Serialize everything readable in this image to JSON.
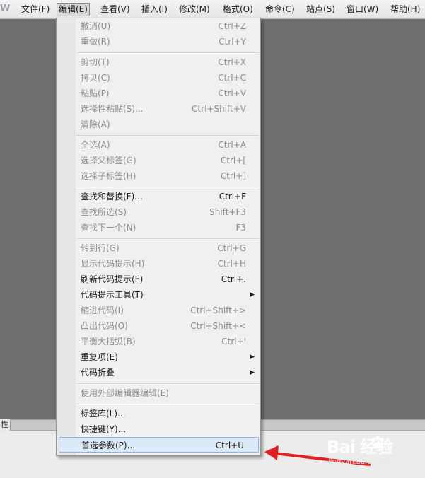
{
  "app": {
    "logo": "W"
  },
  "menubar": [
    {
      "label": "文件(F)"
    },
    {
      "label": "编辑(E)",
      "active": true
    },
    {
      "label": "查看(V)"
    },
    {
      "label": "插入(I)"
    },
    {
      "label": "修改(M)"
    },
    {
      "label": "格式(O)"
    },
    {
      "label": "命令(C)"
    },
    {
      "label": "站点(S)"
    },
    {
      "label": "窗口(W)"
    },
    {
      "label": "帮助(H)"
    }
  ],
  "edit_menu": {
    "items": [
      {
        "label": "撤消(U)",
        "shortcut": "Ctrl+Z",
        "enabled": false
      },
      {
        "label": "重做(R)",
        "shortcut": "Ctrl+Y",
        "enabled": false
      },
      {
        "label": "剪切(T)",
        "shortcut": "Ctrl+X",
        "enabled": false
      },
      {
        "label": "拷贝(C)",
        "shortcut": "Ctrl+C",
        "enabled": false
      },
      {
        "label": "粘贴(P)",
        "shortcut": "Ctrl+V",
        "enabled": false
      },
      {
        "label": "选择性粘贴(S)...",
        "shortcut": "Ctrl+Shift+V",
        "enabled": false
      },
      {
        "label": "清除(A)",
        "shortcut": "",
        "enabled": false
      },
      {
        "label": "全选(A)",
        "shortcut": "Ctrl+A",
        "enabled": false
      },
      {
        "label": "选择父标签(G)",
        "shortcut": "Ctrl+[",
        "enabled": false
      },
      {
        "label": "选择子标签(H)",
        "shortcut": "Ctrl+]",
        "enabled": false
      },
      {
        "label": "查找和替换(F)...",
        "shortcut": "Ctrl+F",
        "enabled": true
      },
      {
        "label": "查找所选(S)",
        "shortcut": "Shift+F3",
        "enabled": false
      },
      {
        "label": "查找下一个(N)",
        "shortcut": "F3",
        "enabled": false
      },
      {
        "label": "转到行(G)",
        "shortcut": "Ctrl+G",
        "enabled": false
      },
      {
        "label": "显示代码提示(H)",
        "shortcut": "Ctrl+H",
        "enabled": false
      },
      {
        "label": "刷新代码提示(F)",
        "shortcut": "Ctrl+.",
        "enabled": true
      },
      {
        "label": "代码提示工具(T)",
        "shortcut": "",
        "enabled": true,
        "submenu": true
      },
      {
        "label": "缩进代码(I)",
        "shortcut": "Ctrl+Shift+>",
        "enabled": false
      },
      {
        "label": "凸出代码(O)",
        "shortcut": "Ctrl+Shift+<",
        "enabled": false
      },
      {
        "label": "平衡大括弧(B)",
        "shortcut": "Ctrl+'",
        "enabled": false
      },
      {
        "label": "重复项(E)",
        "shortcut": "",
        "enabled": true,
        "submenu": true
      },
      {
        "label": "代码折叠",
        "shortcut": "",
        "enabled": true,
        "submenu": true
      },
      {
        "label": "使用外部编辑器编辑(E)",
        "shortcut": "",
        "enabled": false
      },
      {
        "label": "标签库(L)...",
        "shortcut": "",
        "enabled": true
      },
      {
        "label": "快捷键(Y)...",
        "shortcut": "",
        "enabled": true
      },
      {
        "label": "首选参数(P)...",
        "shortcut": "Ctrl+U",
        "enabled": true,
        "highlighted": true
      }
    ]
  },
  "panel": {
    "tab_label": "性"
  },
  "watermark": {
    "brand": "Bai  经验",
    "site": "jingyan.baidu.com"
  },
  "colors": {
    "highlight": "#dbe8f7",
    "highlight_border": "#8fb4e0",
    "arrow": "#e02020",
    "disabled_text": "#8d8d8d"
  }
}
